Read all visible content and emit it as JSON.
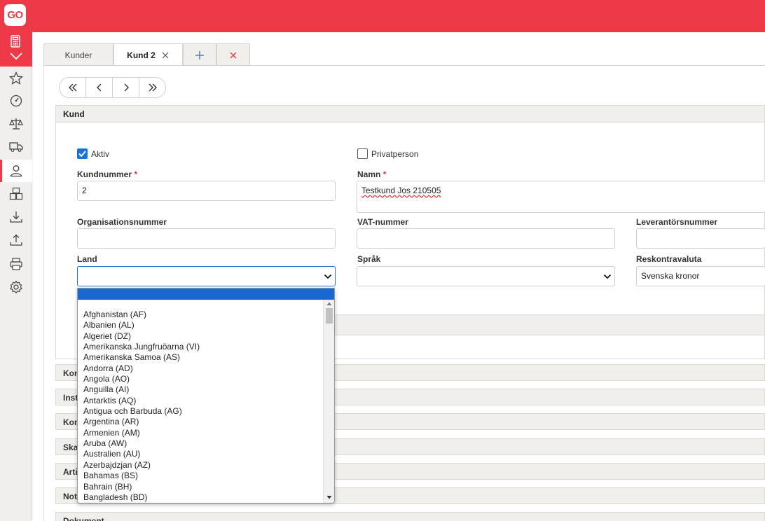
{
  "app": {
    "logo_text": "GO",
    "accent": "#ee3a48"
  },
  "sidebar": {
    "icons": [
      "calculator-icon",
      "chevron-down-icon",
      "star-icon",
      "dashboard-icon",
      "scale-icon",
      "truck-icon",
      "user-icon",
      "boxes-icon",
      "download-icon",
      "upload-icon",
      "printer-icon",
      "settings-icon"
    ]
  },
  "tabs": [
    {
      "label": "Kunder"
    },
    {
      "label": "Kund 2"
    }
  ],
  "record_nav": [
    "first",
    "previous",
    "next",
    "last"
  ],
  "kund_section": {
    "title": "Kund",
    "aktiv_label": "Aktiv",
    "aktiv_checked": true,
    "privatperson_label": "Privatperson",
    "privatperson_checked": false,
    "kundnummer_label": "Kundnummer",
    "kundnummer_value": "2",
    "namn_label": "Namn",
    "namn_value": "Testkund Jos 210505",
    "orgnr_label": "Organisationsnummer",
    "orgnr_value": "",
    "vat_label": "VAT-nummer",
    "vat_value": "",
    "levnr_label": "Leverantörsnummer",
    "levnr_value": "",
    "land_label": "Land",
    "land_value": "",
    "sprak_label": "Språk",
    "sprak_value": "",
    "valuta_label": "Reskontravaluta",
    "valuta_value": "Svenska kronor",
    "required_mark": "*"
  },
  "sections": [
    {
      "label": "Kont"
    },
    {
      "label": "Insta"
    },
    {
      "label": "Kont"
    },
    {
      "label": "Skat"
    },
    {
      "label": "Artik"
    },
    {
      "label": "Note"
    },
    {
      "label": "Dokument"
    }
  ],
  "land_dropdown": {
    "options": [
      "Afghanistan (AF)",
      "Albanien (AL)",
      "Algeriet (DZ)",
      "Amerikanska Jungfruöarna (VI)",
      "Amerikanska Samoa (AS)",
      "Andorra (AD)",
      "Angola (AO)",
      "Anguilla (AI)",
      "Antarktis (AQ)",
      "Antigua och Barbuda (AG)",
      "Argentina (AR)",
      "Armenien (AM)",
      "Aruba (AW)",
      "Australien (AU)",
      "Azerbajdzjan (AZ)",
      "Bahamas (BS)",
      "Bahrain (BH)",
      "Bangladesh (BD)"
    ]
  }
}
